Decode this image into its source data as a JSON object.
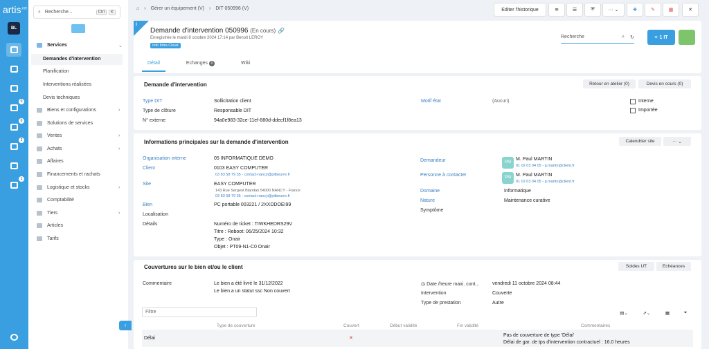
{
  "rail": {
    "logo": "artis",
    "logo_sup": ".net",
    "avatar": "BL",
    "badges": [
      "0",
      "0",
      "2",
      "1"
    ]
  },
  "sidebar": {
    "search_placeholder": "Recherche...",
    "kbd1": "Ctrl",
    "kbd2": "K",
    "sections": [
      {
        "label": "Services",
        "expanded": true
      },
      {
        "label": "Biens et configurations"
      },
      {
        "label": "Solutions de services"
      },
      {
        "label": "Ventes"
      },
      {
        "label": "Achats"
      },
      {
        "label": "Affaires"
      },
      {
        "label": "Financements et rachats"
      },
      {
        "label": "Logistique et stocks"
      },
      {
        "label": "Comptabilité"
      },
      {
        "label": "Tiers"
      },
      {
        "label": "Articles"
      },
      {
        "label": "Tarifs"
      }
    ],
    "subs": [
      "Demandes d'intervention",
      "Planification",
      "Interventions réalisées",
      "Devis techniques"
    ]
  },
  "topbar": {
    "breadcrumb": [
      "Gérer un équipement (V)",
      "DIT 050996 (V)"
    ],
    "history": "Editer l'historique"
  },
  "header": {
    "info": "i",
    "title": "Demande d'intervention 050996",
    "status": "(En cours)",
    "sub": "Enregistrée le mardi 8 octobre 2024 17:14 par Benoit LEROY",
    "tag": "Info Infra Cloud",
    "search": "Recherche",
    "btn_it": "1 IT",
    "tabs": [
      {
        "label": "Détail"
      },
      {
        "label": "Echanges",
        "count": "0"
      },
      {
        "label": "Wiki"
      }
    ]
  },
  "dit": {
    "title": "Demande d'intervention",
    "btn_retour": "Retour en atelier (0)",
    "btn_devis": "Devis en cours (0)",
    "type_label": "Type DIT",
    "type_val": "Sollicitation client",
    "cloture_label": "Type de clôture",
    "cloture_val": "Responsable DIT",
    "ext_label": "N° externe",
    "ext_val": "94a0e983-32ce-11ef-880d-ddecf1f8ea13",
    "motif_label": "Motif état",
    "motif_val": "(Aucun)",
    "interne": "Interne",
    "importee": "Importée"
  },
  "main": {
    "title": "Informations principales sur la demande d'intervention",
    "btn_cal": "Calendrier site",
    "btn_more": "···",
    "org_label": "Organisation interne",
    "org_val": "05 INFORMATIQUE DEMO",
    "client_label": "Client",
    "client_val": "0103 EASY COMPUTER",
    "client_contact": "03 83 58 79 35 - contact-nancy@pitbeurre.fr",
    "site_label": "Site",
    "site_val": "EASY COMPUTER",
    "site_addr": "143 Rue Sergent Blandan 54000 NANCY - France",
    "site_contact": "03 83 58 79 35 - contact-nancy@pitbeurre.fr",
    "bien_label": "Bien",
    "bien_val": "PC portable 003221 / 2XXDDOEI99",
    "loc_label": "Localisation",
    "details_label": "Détails",
    "details": [
      "Numéro de ticket : TIWKHEDRS29V",
      "Titre : Reboot: 06/25/2024 10:32",
      "Type : Onair",
      "Objet : PT09-N1-C0 Onair"
    ],
    "dem_label": "Demandeur",
    "dem_initials": "PM",
    "dem_name": "M. Paul MARTIN",
    "dem_contact": "01 02 03 04 05 - p.martin@client.fr",
    "pc_label": "Personne à contacter",
    "pc_initials": "PM",
    "pc_name": "M. Paul MARTIN",
    "pc_contact": "01 02 03 04 05 - p.martin@client.fr",
    "dom_label": "Domaine",
    "dom_val": "Informatique",
    "nat_label": "Nature",
    "nat_val": "Maintenance curative",
    "symp_label": "Symptôme"
  },
  "cov": {
    "title": "Couvertures sur le bien et/ou le client",
    "btn_soldes": "Soldes UT",
    "btn_ech": "Echéances",
    "com_label": "Commentaire",
    "com_1": "Le bien a été livré le 31/12/2022",
    "com_2": "Le bien a un statut ssc Non couvert",
    "date_label": "Date /heure maxi. cont...",
    "date_val": "vendredi 11 octobre 2024 08:44",
    "int_label": "Intervention",
    "int_val": "Couverte",
    "prest_label": "Type de prestation",
    "prest_val": "Autre",
    "filter": "Filtre",
    "cols": [
      "Type de couverture",
      "Couvert",
      "Début validité",
      "Fin validité",
      "Commentaires"
    ],
    "row": {
      "name": "Délai",
      "couvert": "✕",
      "c1": "Pas de couverture de type 'Délai'",
      "c2": "Délai de gar. de tps d'intervention contractuel : 16.0 heures"
    }
  }
}
